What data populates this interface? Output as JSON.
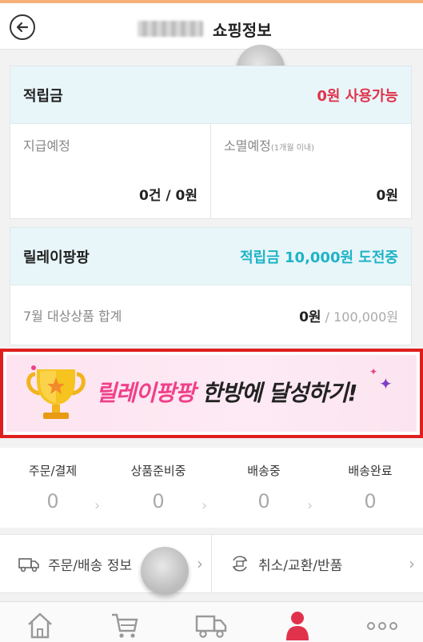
{
  "header": {
    "title": "쇼핑정보",
    "back_icon": "back-arrow-icon"
  },
  "reward": {
    "title": "적립금",
    "status": "0원 사용가능",
    "pending_label": "지급예정",
    "pending_value": "0건 / 0원",
    "expiring_label": "소멸예정",
    "expiring_note": "(1개월 이내)",
    "expiring_value": "0원"
  },
  "relay": {
    "title": "릴레이팡팡",
    "status": "적립금 10,000원 도전중",
    "sum_label": "7월 대상상품 합계",
    "sum_value": "0원",
    "sum_goal": " / 100,000원"
  },
  "banner": {
    "highlight": "릴레이팡팡",
    "text": " 한방에 달성하기!"
  },
  "order_status": [
    {
      "label": "주문/결제",
      "count": "0"
    },
    {
      "label": "상품준비중",
      "count": "0"
    },
    {
      "label": "배송중",
      "count": "0"
    },
    {
      "label": "배송완료",
      "count": "0"
    }
  ],
  "info_links": {
    "order_delivery": "주문/배송 정보",
    "cancel_exchange": "취소/교환/반품"
  },
  "tabbar": {
    "items": [
      "home-icon",
      "cart-icon",
      "truck-icon",
      "person-icon",
      "more-icon"
    ],
    "active_color": "#e0334b"
  },
  "colors": {
    "accent_red": "#e0334b",
    "accent_cyan": "#1fb3c7",
    "banner_pink": "#f0408a"
  }
}
